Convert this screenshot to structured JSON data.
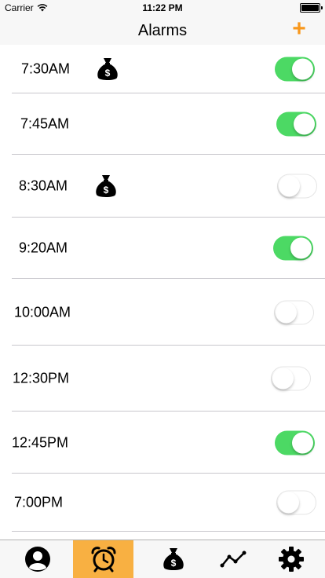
{
  "status_bar": {
    "carrier": "Carrier",
    "time": "11:22 PM"
  },
  "nav_bar": {
    "title": "Alarms",
    "add_label": "+"
  },
  "colors": {
    "accent": "#f8981d",
    "toggle_on": "#4cd964",
    "active_tab": "#f8b042"
  },
  "alarms": [
    {
      "time": "7:30AM",
      "has_money_icon": true,
      "enabled": true
    },
    {
      "time": "7:45AM",
      "has_money_icon": false,
      "enabled": true
    },
    {
      "time": "8:30AM",
      "has_money_icon": true,
      "enabled": false
    },
    {
      "time": "9:20AM",
      "has_money_icon": false,
      "enabled": true
    },
    {
      "time": "10:00AM",
      "has_money_icon": false,
      "enabled": false
    },
    {
      "time": "12:30PM",
      "has_money_icon": false,
      "enabled": false
    },
    {
      "time": "12:45PM",
      "has_money_icon": false,
      "enabled": true
    },
    {
      "time": "7:00PM",
      "has_money_icon": false,
      "enabled": false
    }
  ],
  "tab_bar": {
    "tabs": [
      {
        "icon": "profile-icon",
        "active": false
      },
      {
        "icon": "alarm-clock-icon",
        "active": true
      },
      {
        "icon": "money-bag-icon",
        "active": false
      },
      {
        "icon": "trend-line-icon",
        "active": false
      },
      {
        "icon": "gear-icon",
        "active": false
      }
    ]
  }
}
